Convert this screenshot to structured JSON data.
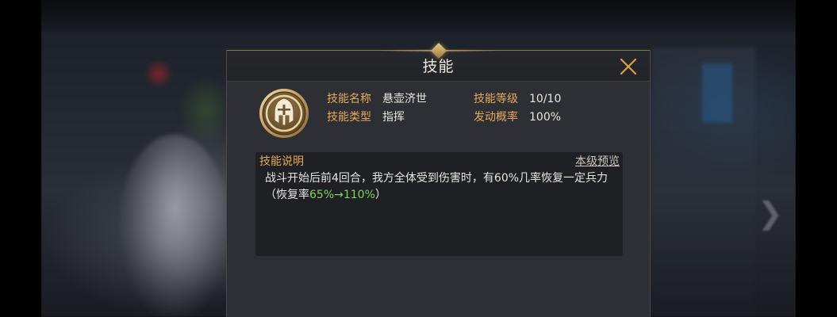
{
  "dialog": {
    "title": "技能",
    "close_icon": "close-icon"
  },
  "skill": {
    "icon": "knight-helmet-icon",
    "name_label": "技能名称",
    "name_value": "悬壶济世",
    "type_label": "技能类型",
    "type_value": "指挥",
    "level_label": "技能等级",
    "level_value": "10/10",
    "rate_label": "发动概率",
    "rate_value": "100%"
  },
  "description": {
    "label": "技能说明",
    "preview_link": "本级预览",
    "text_main": "战斗开始后前4回合，我方全体受到伤害时，有60%几率恢复一定兵力（恢复率",
    "text_highlight": "65%→110%",
    "text_end": "）"
  },
  "colors": {
    "accent_gold": "#e6a95a",
    "highlight_green": "#7ed35a",
    "panel_bg": "#2e2f35"
  }
}
